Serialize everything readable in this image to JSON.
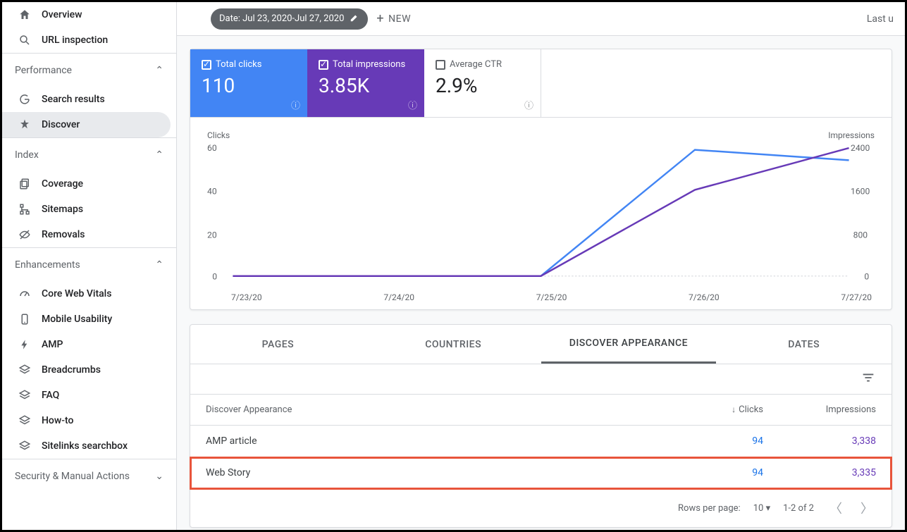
{
  "sidebar": {
    "overview": "Overview",
    "url_inspection": "URL inspection",
    "sections": {
      "performance": {
        "title": "Performance",
        "items": [
          "Search results",
          "Discover"
        ]
      },
      "index": {
        "title": "Index",
        "items": [
          "Coverage",
          "Sitemaps",
          "Removals"
        ]
      },
      "enhancements": {
        "title": "Enhancements",
        "items": [
          "Core Web Vitals",
          "Mobile Usability",
          "AMP",
          "Breadcrumbs",
          "FAQ",
          "How-to",
          "Sitelinks searchbox"
        ]
      },
      "security": {
        "title": "Security & Manual Actions"
      }
    }
  },
  "toolbar": {
    "date_chip": "Date: Jul 23, 2020-Jul 27, 2020",
    "new_label": "NEW",
    "last_updated": "Last u"
  },
  "tiles": {
    "clicks": {
      "label": "Total clicks",
      "value": "110"
    },
    "impressions": {
      "label": "Total impressions",
      "value": "3.85K"
    },
    "ctr": {
      "label": "Average CTR",
      "value": "2.9%"
    }
  },
  "chart_data": {
    "type": "line",
    "left_label": "Clicks",
    "right_label": "Impressions",
    "categories": [
      "7/23/20",
      "7/24/20",
      "7/25/20",
      "7/26/20",
      "7/27/20"
    ],
    "left_ticks": [
      0,
      20,
      40,
      60
    ],
    "right_ticks": [
      0,
      800,
      1600,
      2400
    ],
    "series": [
      {
        "name": "Clicks",
        "color": "#4285f4",
        "axis": "left",
        "values": [
          0,
          0,
          0,
          58,
          53
        ]
      },
      {
        "name": "Impressions",
        "color": "#673ab7",
        "axis": "right",
        "values": [
          0,
          0,
          0,
          1580,
          2350
        ]
      }
    ]
  },
  "table": {
    "tabs": [
      "PAGES",
      "COUNTRIES",
      "DISCOVER APPEARANCE",
      "DATES"
    ],
    "active_tab": 2,
    "col_a": "Discover Appearance",
    "col_b": "Clicks",
    "col_c": "Impressions",
    "rows": [
      {
        "name": "AMP article",
        "clicks": "94",
        "impressions": "3,338",
        "highlight": false
      },
      {
        "name": "Web Story",
        "clicks": "94",
        "impressions": "3,335",
        "highlight": true
      }
    ],
    "pager": {
      "rows_per_page_label": "Rows per page:",
      "rows_per_page": "10",
      "range": "1-2 of 2"
    }
  }
}
